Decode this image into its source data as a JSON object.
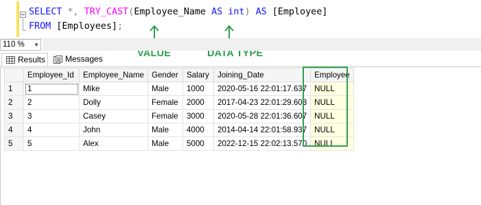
{
  "editor": {
    "line1": [
      {
        "t": "SELECT",
        "k": "kw"
      },
      {
        "t": " ",
        "k": "id"
      },
      {
        "t": "*,",
        "k": "op"
      },
      {
        "t": " ",
        "k": "id"
      },
      {
        "t": "TRY_CAST",
        "k": "fn"
      },
      {
        "t": "(",
        "k": "op"
      },
      {
        "t": "Employee_Name",
        "k": "id"
      },
      {
        "t": " ",
        "k": "id"
      },
      {
        "t": "AS",
        "k": "kw"
      },
      {
        "t": " ",
        "k": "id"
      },
      {
        "t": "int",
        "k": "kw"
      },
      {
        "t": ")",
        "k": "op"
      },
      {
        "t": " ",
        "k": "id"
      },
      {
        "t": "AS",
        "k": "kw"
      },
      {
        "t": " [Employee]",
        "k": "id"
      }
    ],
    "line2": [
      {
        "t": "FROM",
        "k": "kw"
      },
      {
        "t": " [Employees]",
        "k": "id"
      },
      {
        "t": ";",
        "k": "op"
      }
    ]
  },
  "annotations": {
    "value_label": "VALUE",
    "datatype_label": "DATA TYPE",
    "color": "#2e9e4f"
  },
  "zoom": {
    "value": "110 %"
  },
  "tabs": {
    "results": "Results",
    "messages": "Messages"
  },
  "results": {
    "columns": [
      "Employee_Id",
      "Employee_Name",
      "Gender",
      "Salary",
      "Joining_Date",
      "Employee"
    ],
    "rows": [
      {
        "rn": "1",
        "cells": [
          "1",
          "Mike",
          "Male",
          "1000",
          "2020-05-16 22:01:17.637",
          "NULL"
        ]
      },
      {
        "rn": "2",
        "cells": [
          "2",
          "Dolly",
          "Female",
          "2000",
          "2017-04-23 22:01:29.603",
          "NULL"
        ]
      },
      {
        "rn": "3",
        "cells": [
          "3",
          "Casey",
          "Female",
          "3000",
          "2020-05-28 22:01:36.607",
          "NULL"
        ]
      },
      {
        "rn": "4",
        "cells": [
          "4",
          "John",
          "Male",
          "4000",
          "2014-04-14 22:01:58.937",
          "NULL"
        ]
      },
      {
        "rn": "5",
        "cells": [
          "5",
          "Alex",
          "Male",
          "5000",
          "2022-12-15 22:02:13.570",
          "NULL"
        ]
      }
    ]
  }
}
